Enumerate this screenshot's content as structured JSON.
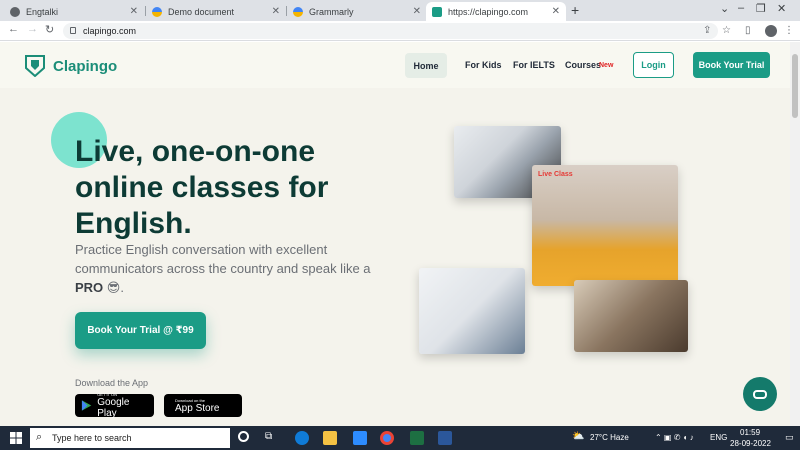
{
  "browser": {
    "tabs": [
      {
        "label": "Engtalki",
        "active": false,
        "favicon_color": "#5f6368"
      },
      {
        "label": "Demo document",
        "active": false,
        "favicon_color": "#f4b400"
      },
      {
        "label": "Grammarly",
        "active": false,
        "favicon_color": "#f4b400"
      },
      {
        "label": "https://clapingo.com",
        "active": true,
        "favicon_color": "#1b9c86"
      }
    ],
    "url": "clapingo.com",
    "window_controls": [
      "–",
      "❐",
      "✕"
    ]
  },
  "site": {
    "brand": "Clapingo",
    "nav": {
      "home": "Home",
      "kids": "For Kids",
      "ielts": "For IELTS",
      "courses": "Courses",
      "new_badge": "New",
      "login": "Login",
      "book_trial": "Book Your Trial"
    },
    "hero": {
      "title": "Live, one-on-one online classes for English.",
      "subtitle_start": "Practice English conversation with excellent communicators across the country and speak like a ",
      "subtitle_bold": "PRO",
      "subtitle_emoji": "😎",
      "subtitle_end": ".",
      "cta": "Book Your Trial @ ₹99"
    },
    "download": {
      "label": "Download the App",
      "google_small": "GET IT ON",
      "google_big": "Google Play",
      "apple_small": "Download on the",
      "apple_big": "App Store"
    },
    "live_class_label": "Live Class",
    "accent_color": "#1b9c86"
  },
  "taskbar": {
    "search_placeholder": "Type here to search",
    "weather": "27°C  Haze",
    "lang": "ENG",
    "time": "01:59",
    "date": "28-09-2022"
  }
}
